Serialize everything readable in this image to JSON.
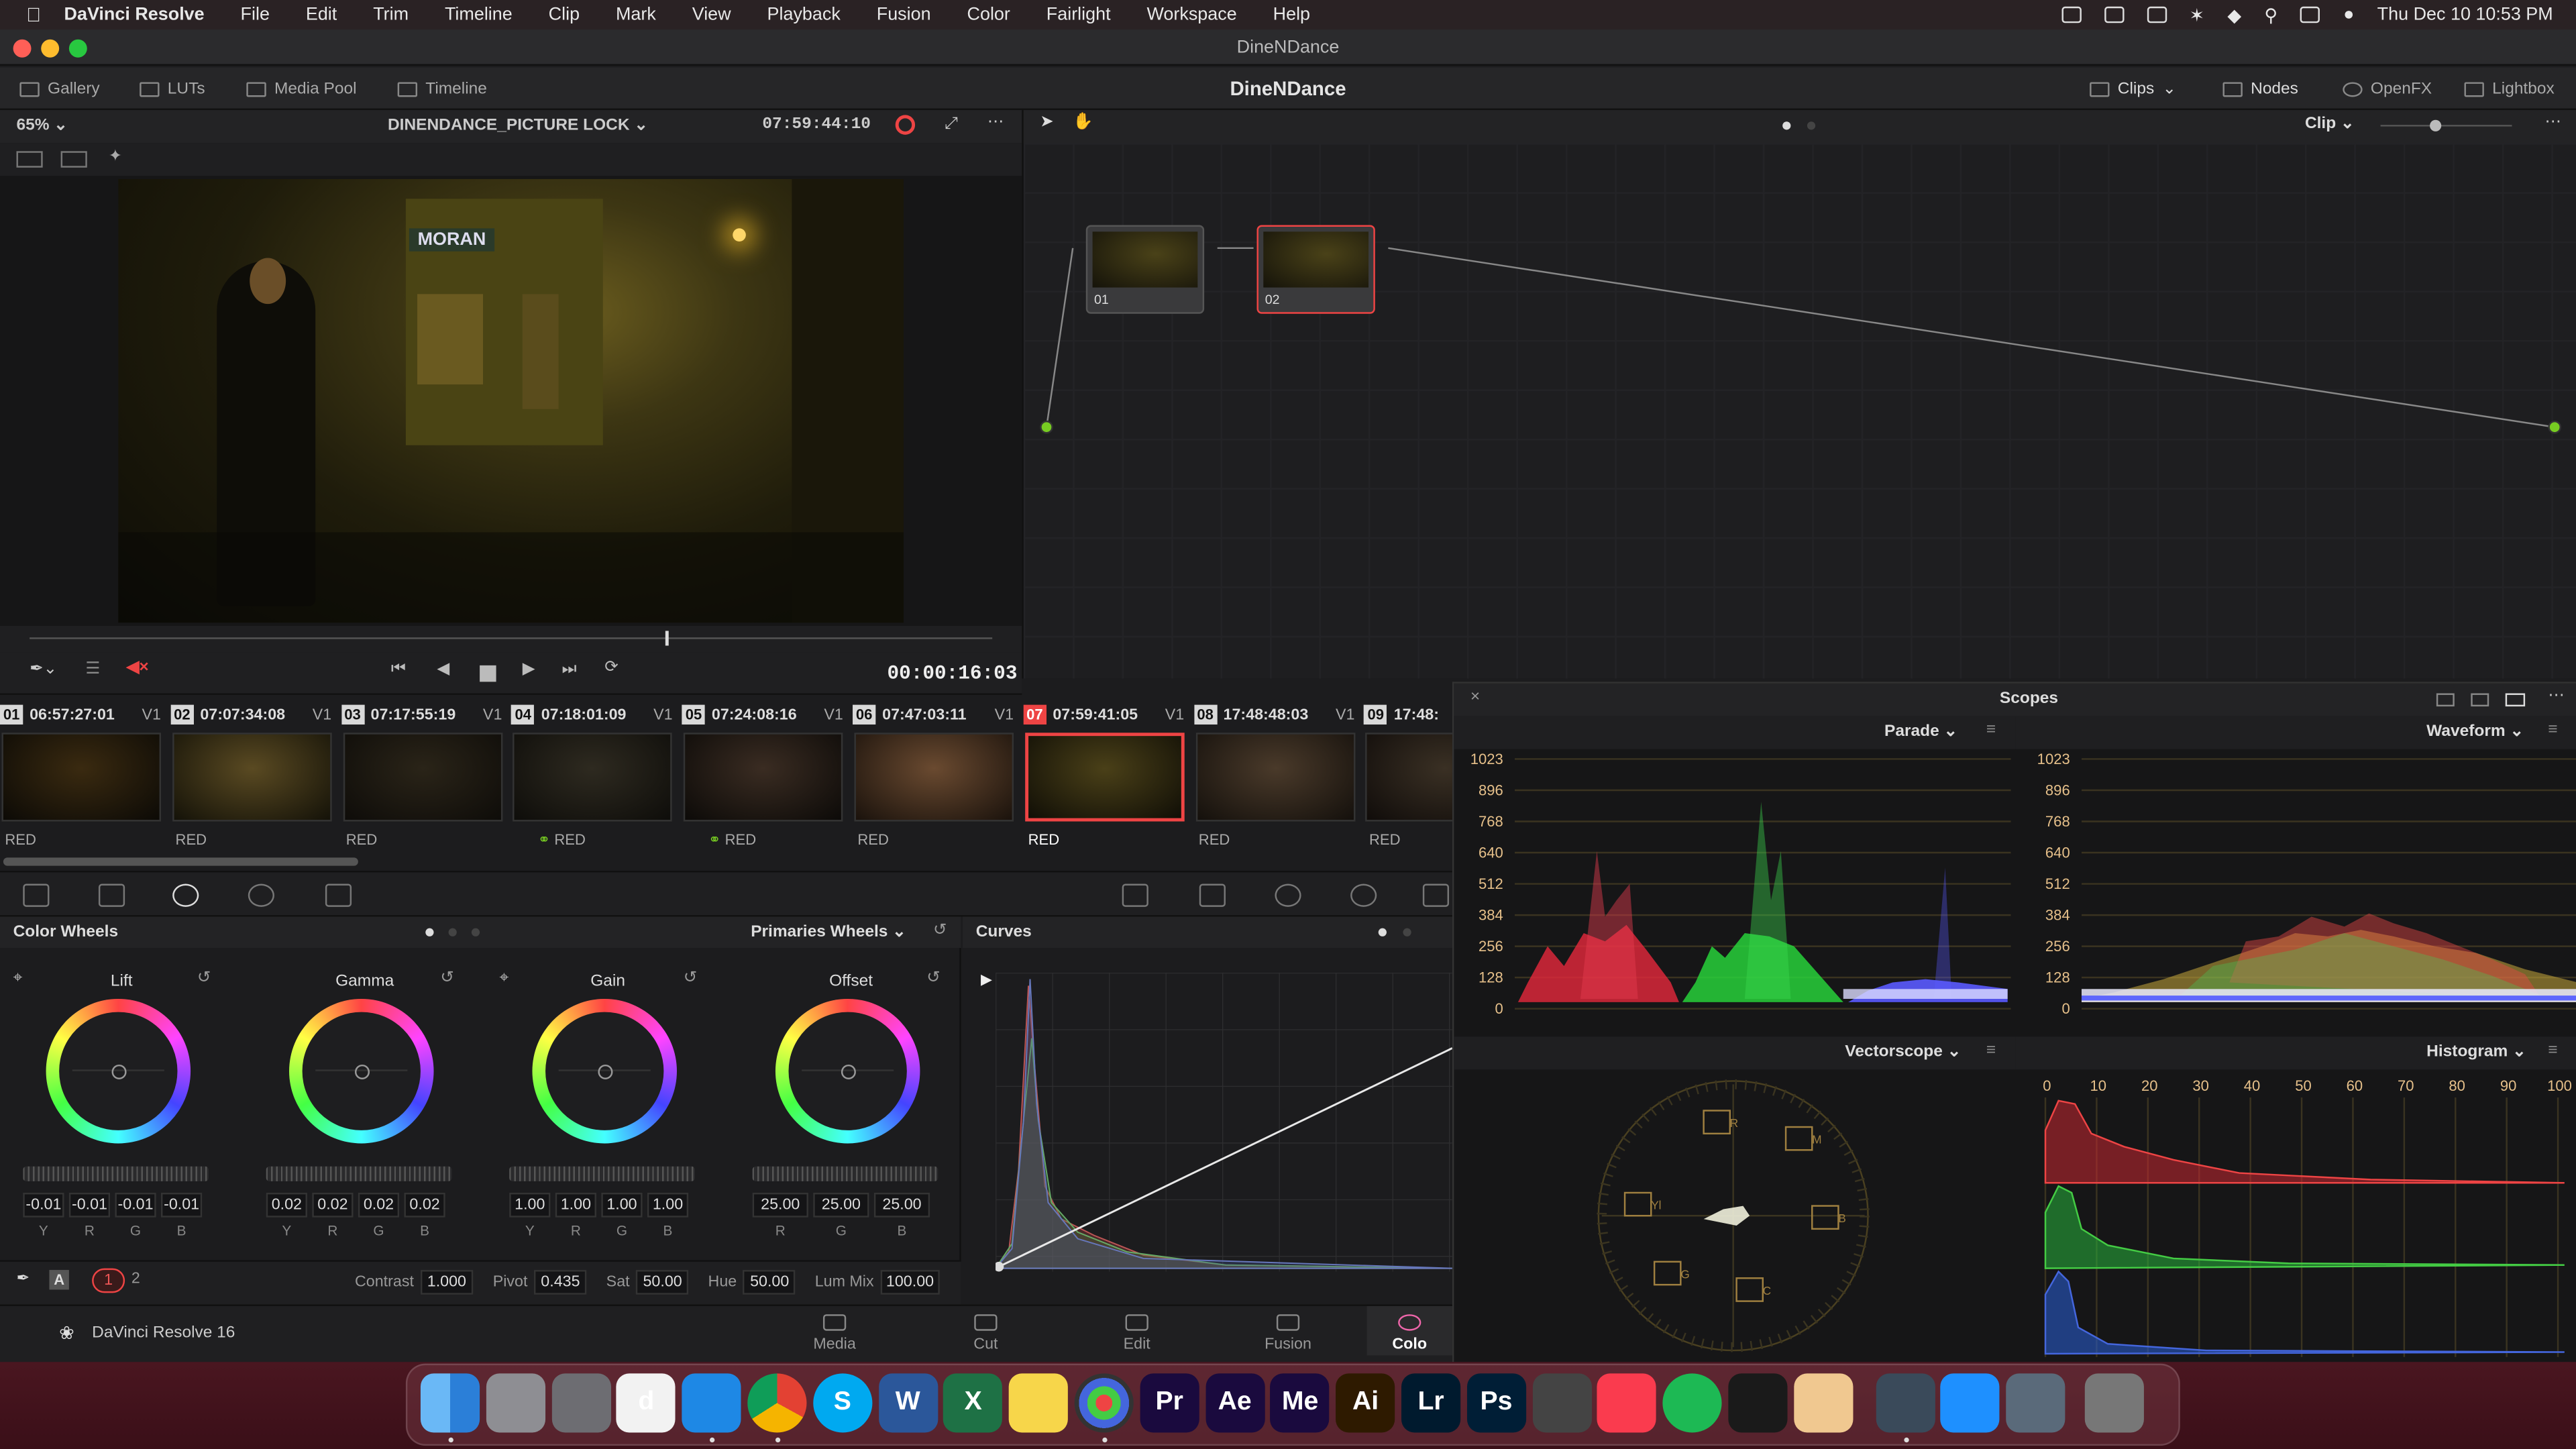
{
  "menubar": {
    "app_name": "DaVinci Resolve",
    "items": [
      "File",
      "Edit",
      "Trim",
      "Timeline",
      "Clip",
      "Mark",
      "View",
      "Playback",
      "Fusion",
      "Color",
      "Fairlight",
      "Workspace",
      "Help"
    ],
    "clock": "Thu Dec 10  10:53 PM"
  },
  "window": {
    "title": "DineNDance"
  },
  "toolbar": {
    "gallery": "Gallery",
    "luts": "LUTs",
    "media_pool": "Media Pool",
    "timeline": "Timeline",
    "project_title": "DineNDance",
    "clips": "Clips",
    "nodes": "Nodes",
    "openfx": "OpenFX",
    "lightbox": "Lightbox"
  },
  "viewer": {
    "zoom": "65%",
    "timeline_name": "DINENDANCE_PICTURE LOCK",
    "source_timecode": "07:59:44:10",
    "playhead_timecode": "00:00:16:03",
    "scrub_position": 0.66,
    "sign_text": "MORAN"
  },
  "node_editor": {
    "mode": "Clip",
    "nodes": [
      {
        "label": "01"
      },
      {
        "label": "02"
      }
    ]
  },
  "clips": [
    {
      "num": "01",
      "tc": "06:57:27:01",
      "track": "V1",
      "codec": "RED",
      "linked": false,
      "c1": "#3a2a10",
      "c2": "#0c0a06"
    },
    {
      "num": "02",
      "tc": "07:07:34:08",
      "track": "V1",
      "codec": "RED",
      "linked": false,
      "c1": "#5a4a22",
      "c2": "#141208"
    },
    {
      "num": "03",
      "tc": "07:17:55:19",
      "track": "V1",
      "codec": "RED",
      "linked": false,
      "c1": "#2a2418",
      "c2": "#0e0c09"
    },
    {
      "num": "04",
      "tc": "07:18:01:09",
      "track": "V1",
      "codec": "RED",
      "linked": true,
      "c1": "#2e2a20",
      "c2": "#0e0d0a"
    },
    {
      "num": "05",
      "tc": "07:24:08:16",
      "track": "V1",
      "codec": "RED",
      "linked": true,
      "c1": "#3a2c22",
      "c2": "#0c0a08"
    },
    {
      "num": "06",
      "tc": "07:47:03:11",
      "track": "V1",
      "codec": "RED",
      "linked": false,
      "c1": "#6a4a30",
      "c2": "#1a120c"
    },
    {
      "num": "07",
      "tc": "07:59:41:05",
      "track": "V1",
      "codec": "RED",
      "linked": false,
      "c1": "#4a4018",
      "c2": "#100e06",
      "selected": true
    },
    {
      "num": "08",
      "tc": "17:48:48:03",
      "track": "V1",
      "codec": "RED",
      "linked": false,
      "c1": "#4a3a2a",
      "c2": "#14100c"
    },
    {
      "num": "09",
      "tc": "17:48:",
      "track": "",
      "codec": "RED",
      "linked": false,
      "c1": "#3a3024",
      "c2": "#100c0a"
    }
  ],
  "color_wheels": {
    "title": "Color Wheels",
    "mode": "Primaries Wheels",
    "wheels": [
      {
        "name": "Lift",
        "values": [
          "-0.01",
          "-0.01",
          "-0.01",
          "-0.01"
        ],
        "channels": [
          "Y",
          "R",
          "G",
          "B"
        ]
      },
      {
        "name": "Gamma",
        "values": [
          "0.02",
          "0.02",
          "0.02",
          "0.02"
        ],
        "channels": [
          "Y",
          "R",
          "G",
          "B"
        ]
      },
      {
        "name": "Gain",
        "values": [
          "1.00",
          "1.00",
          "1.00",
          "1.00"
        ],
        "channels": [
          "Y",
          "R",
          "G",
          "B"
        ]
      },
      {
        "name": "Offset",
        "values": [
          "25.00",
          "25.00",
          "25.00"
        ],
        "channels": [
          "R",
          "G",
          "B"
        ]
      }
    ],
    "bottom": {
      "page1": "1",
      "page2": "2",
      "contrast_label": "Contrast",
      "contrast": "1.000",
      "pivot_label": "Pivot",
      "pivot": "0.435",
      "sat_label": "Sat",
      "sat": "50.00",
      "hue_label": "Hue",
      "hue": "50.00",
      "lummix_label": "Lum Mix",
      "lummix": "100.00"
    }
  },
  "curves": {
    "title": "Curves"
  },
  "scopes": {
    "title": "Scopes",
    "parade": "Parade",
    "waveform": "Waveform",
    "vectorscope": "Vectorscope",
    "histogram": "Histogram",
    "wave_scale": [
      "1023",
      "896",
      "768",
      "640",
      "512",
      "384",
      "256",
      "128",
      "0"
    ],
    "hist_scale": [
      "0",
      "10",
      "20",
      "30",
      "40",
      "50",
      "60",
      "70",
      "80",
      "90",
      "100"
    ],
    "vector_targets": [
      "R",
      "M",
      "B",
      "C",
      "G",
      "Yl"
    ]
  },
  "pages": {
    "app_label": "DaVinci Resolve 16",
    "media": "Media",
    "cut": "Cut",
    "edit": "Edit",
    "fusion": "Fusion",
    "color": "Colo"
  },
  "dock": [
    {
      "name": "finder",
      "label": "",
      "bg": "#3a8fe6"
    },
    {
      "name": "launchpad",
      "label": "",
      "bg": "#8e8e93"
    },
    {
      "name": "system-preferences",
      "label": "",
      "bg": "#6d6d72"
    },
    {
      "name": "davinci-old",
      "label": "d",
      "bg": "#f2f2f2"
    },
    {
      "name": "safari",
      "label": "",
      "bg": "#1e88e5"
    },
    {
      "name": "chrome",
      "label": "",
      "bg": "#e8e8e8"
    },
    {
      "name": "skype",
      "label": "S",
      "bg": "#00a9f0"
    },
    {
      "name": "word",
      "label": "W",
      "bg": "#2b579a"
    },
    {
      "name": "excel",
      "label": "X",
      "bg": "#1e7145"
    },
    {
      "name": "notes",
      "label": "",
      "bg": "#f7d64a"
    },
    {
      "name": "davinci-resolve",
      "label": "",
      "bg": "#2a2a2c"
    },
    {
      "name": "premiere",
      "label": "Pr",
      "bg": "#1a0a3e"
    },
    {
      "name": "after-effects",
      "label": "Ae",
      "bg": "#1a0a3e"
    },
    {
      "name": "media-encoder",
      "label": "Me",
      "bg": "#1a0a3e"
    },
    {
      "name": "illustrator",
      "label": "Ai",
      "bg": "#2e1a00"
    },
    {
      "name": "lightroom",
      "label": "Lr",
      "bg": "#001a2e"
    },
    {
      "name": "photoshop",
      "label": "Ps",
      "bg": "#001e36"
    },
    {
      "name": "garageband",
      "label": "",
      "bg": "#444"
    },
    {
      "name": "music",
      "label": "",
      "bg": "#fa3b4e"
    },
    {
      "name": "spotify",
      "label": "",
      "bg": "#1db954"
    },
    {
      "name": "vlc",
      "label": "",
      "bg": "#1a1a1a"
    },
    {
      "name": "preview",
      "label": "",
      "bg": "#f0c890"
    },
    {
      "name": "quicktime",
      "label": "",
      "bg": "#3a4a5a"
    },
    {
      "name": "app-store",
      "label": "",
      "bg": "#1e90ff"
    },
    {
      "name": "desktop",
      "label": "",
      "bg": "#5a6a7a"
    },
    {
      "name": "trash",
      "label": "",
      "bg": "#777"
    }
  ]
}
